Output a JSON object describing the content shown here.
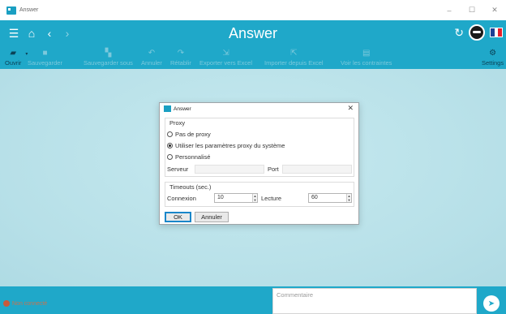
{
  "window": {
    "title": "Answer",
    "controls": [
      "minimize-icon",
      "maximize-icon",
      "close-icon"
    ]
  },
  "header": {
    "title": "Answer",
    "nav_icons": [
      "menu-icon",
      "home-icon",
      "back-icon",
      "forward-icon"
    ],
    "right_icons": [
      "refresh-icon",
      "brand-logo",
      "flag-fr-icon"
    ],
    "flag_colors": [
      "#1d3f95",
      "#ffffff",
      "#e4202c"
    ]
  },
  "toolbar": {
    "items": [
      {
        "label": "Ouvrir",
        "icon": "open-folder-icon",
        "enabled": true
      },
      {
        "label": "Sauvegarder",
        "icon": "save-icon",
        "enabled": false
      },
      {
        "label": "Sauvegarder sous",
        "icon": "save-as-icon",
        "enabled": false
      },
      {
        "label": "Annuler",
        "icon": "undo-icon",
        "enabled": false
      },
      {
        "label": "Rétablir",
        "icon": "redo-icon",
        "enabled": false
      },
      {
        "label": "Exporter vers Excel",
        "icon": "export-excel-icon",
        "enabled": false
      },
      {
        "label": "Importer depuis Excel",
        "icon": "import-excel-icon",
        "enabled": false
      },
      {
        "label": "Voir les contraintes",
        "icon": "constraints-icon",
        "enabled": false
      },
      {
        "label": "Settings",
        "icon": "settings-icon",
        "enabled": true
      }
    ]
  },
  "dialog": {
    "title": "Answer",
    "proxy": {
      "group_label": "Proxy",
      "options": [
        {
          "label": "Pas de proxy",
          "checked": false
        },
        {
          "label": "Utiliser les paramètres proxy du système",
          "checked": true
        },
        {
          "label": "Personnalisé",
          "checked": false
        }
      ],
      "server_label": "Serveur",
      "server_value": "",
      "port_label": "Port",
      "port_value": ""
    },
    "timeouts": {
      "group_label": "Timeouts (sec.)",
      "connection_label": "Connexion",
      "connection_value": "10",
      "read_label": "Lecture",
      "read_value": "60"
    },
    "ok_label": "OK",
    "cancel_label": "Annuler"
  },
  "bottom": {
    "status_text": "Non connecté",
    "comment_placeholder": "Commentaire"
  },
  "colors": {
    "accent": "#1fa8c9",
    "background": "#bfe3ea",
    "status": "#c8734f"
  }
}
